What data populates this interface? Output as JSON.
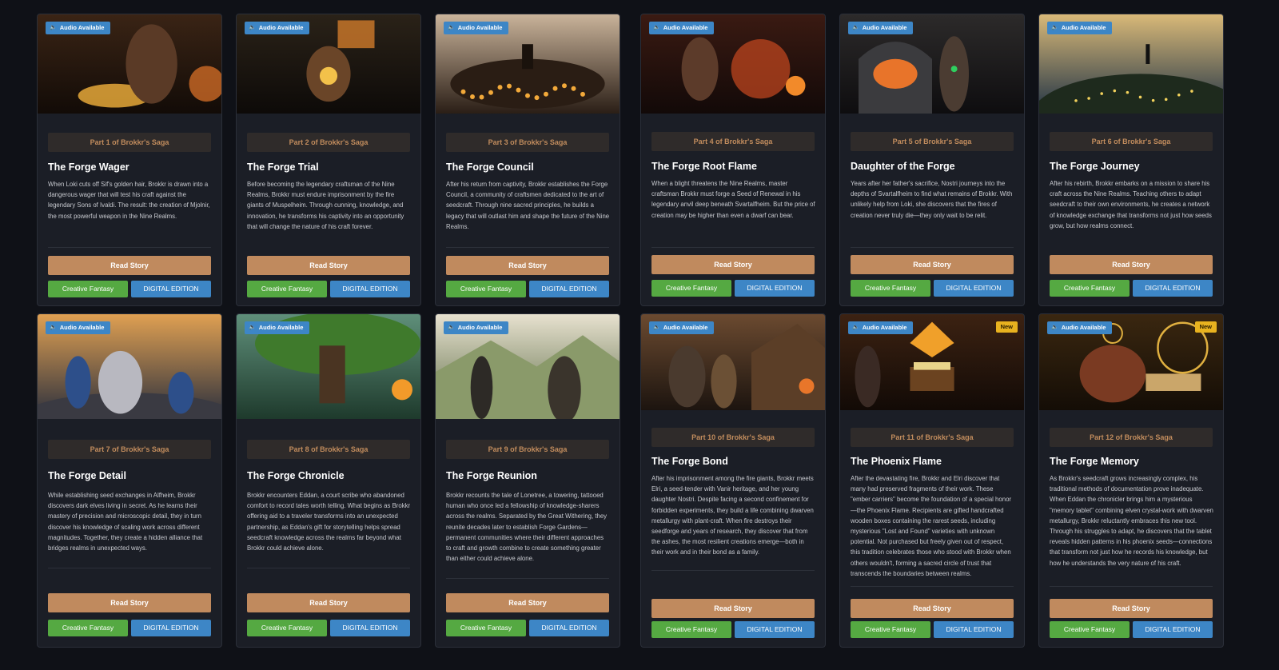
{
  "audio_label": "Audio Available",
  "new_label": "New",
  "read_label": "Read Story",
  "genre_label": "Creative Fantasy",
  "edition_label": "DIGITAL EDITION",
  "colors": {
    "page_bg": "#0f1117",
    "card_bg": "#1b1e26",
    "read_button": "#c08a5e",
    "genre_tag": "#55a942",
    "edition_tag": "#3d86c6",
    "new_badge": "#e8b21f",
    "part_text": "#c18c5d"
  },
  "stories": [
    {
      "part": "Part 1 of Brokkr's Saga",
      "title": "The Forge Wager",
      "description": "When Loki cuts off Sif's golden hair, Brokkr is drawn into a dangerous wager that will test his craft against the legendary Sons of Ivaldi. The result: the creation of Mjolnir, the most powerful weapon in the Nine Realms.",
      "is_new": false,
      "art": "smith-at-forge"
    },
    {
      "part": "Part 2 of Brokkr's Saga",
      "title": "The Forge Trial",
      "description": "Before becoming the legendary craftsman of the Nine Realms, Brokkr must endure imprisonment by the fire giants of Muspelheim. Through cunning, knowledge, and innovation, he transforms his captivity into an opportunity that will change the nature of his craft forever.",
      "is_new": false,
      "art": "dwarf-in-cell"
    },
    {
      "part": "Part 3 of Brokkr's Saga",
      "title": "The Forge Council",
      "description": "After his return from captivity, Brokkr establishes the Forge Council, a community of craftsmen dedicated to the art of seedcraft. Through nine sacred principles, he builds a legacy that will outlast him and shape the future of the Nine Realms.",
      "is_new": false,
      "art": "council-circle"
    },
    {
      "part": "Part 4 of Brokkr's Saga",
      "title": "The Forge Root Flame",
      "description": "When a blight threatens the Nine Realms, master craftsman Brokkr must forge a Seed of Renewal in his legendary anvil deep beneath Svartalfheim. But the price of creation may be higher than even a dwarf can bear.",
      "is_new": false,
      "art": "root-flame-forge"
    },
    {
      "part": "Part 5 of Brokkr's Saga",
      "title": "Daughter of the Forge",
      "description": "Years after her father's sacrifice, Nostri journeys into the depths of Svartalfheim to find what remains of Brokkr. With unlikely help from Loki, she discovers that the fires of creation never truly die—they only wait to be relit.",
      "is_new": false,
      "art": "daughter-at-furnace"
    },
    {
      "part": "Part 6 of Brokkr's Saga",
      "title": "The Forge Journey",
      "description": "After his rebirth, Brokkr embarks on a mission to share his craft across the Nine Realms. Teaching others to adapt seedcraft to their own environments, he creates a network of knowledge exchange that transforms not just how seeds grow, but how realms connect.",
      "is_new": false,
      "art": "hilltop-figure"
    },
    {
      "part": "Part 7 of Brokkr's Saga",
      "title": "The Forge Detail",
      "description": "While establishing seed exchanges in Alfheim, Brokkr discovers dark elves living in secret. As he learns their mastery of precision and microscopic detail, they in turn discover his knowledge of scaling work across different magnitudes. Together, they create a hidden alliance that bridges realms in unexpected ways.",
      "is_new": false,
      "art": "dark-elves-sunset"
    },
    {
      "part": "Part 8 of Brokkr's Saga",
      "title": "The Forge Chronicle",
      "description": "Brokkr encounters Eddan, a court scribe who abandoned comfort to record tales worth telling. What begins as Brokkr offering aid to a traveler transforms into an unexpected partnership, as Eddan's gift for storytelling helps spread seedcraft knowledge across the realms far beyond what Brokkr could achieve alone.",
      "is_new": false,
      "art": "great-tree"
    },
    {
      "part": "Part 9 of Brokkr's Saga",
      "title": "The Forge Reunion",
      "description": "Brokkr recounts the tale of Lonetree, a towering, tattooed human who once led a fellowship of knowledge-sharers across the realms. Separated by the Great Withering, they reunite decades later to establish Forge Gardens—permanent communities where their different approaches to craft and growth combine to create something greater than either could achieve alone.",
      "is_new": false,
      "art": "valley-reunion"
    },
    {
      "part": "Part 10 of Brokkr's Saga",
      "title": "The Forge Bond",
      "description": "After his imprisonment among the fire giants, Brokkr meets Elri, a seed-tender with Vanir heritage, and her young daughter Nostri. Despite facing a second confinement for forbidden experiments, they build a life combining dwarven metallurgy with plant-craft. When fire destroys their seedforge and years of research, they discover that from the ashes, the most resilient creations emerge—both in their work and in their bond as a family.",
      "is_new": false,
      "art": "family-village"
    },
    {
      "part": "Part 11 of Brokkr's Saga",
      "title": "The Phoenix Flame",
      "description": "After the devastating fire, Brokkr and Elri discover that many had preserved fragments of their work. These \"ember carriers\" become the foundation of a special honor—the Phoenix Flame. Recipients are gifted handcrafted wooden boxes containing the rarest seeds, including mysterious \"Lost and Found\" varieties with unknown potential. Not purchased but freely given out of respect, this tradition celebrates those who stood with Brokkr when others wouldn't, forming a sacred circle of trust that transcends the boundaries between realms.",
      "is_new": true,
      "art": "phoenix-chest"
    },
    {
      "part": "Part 12 of Brokkr's Saga",
      "title": "The Forge Memory",
      "description": "As Brokkr's seedcraft grows increasingly complex, his traditional methods of documentation prove inadequate. When Eddan the chronicler brings him a mysterious \"memory tablet\" combining elven crystal-work with dwarven metallurgy, Brokkr reluctantly embraces this new tool. Through his struggles to adapt, he discovers that the tablet reveals hidden patterns in his phoenix seeds—connections that transform not just how he records his knowledge, but how he understands the very nature of his craft.",
      "is_new": true,
      "art": "memory-tablet"
    }
  ]
}
